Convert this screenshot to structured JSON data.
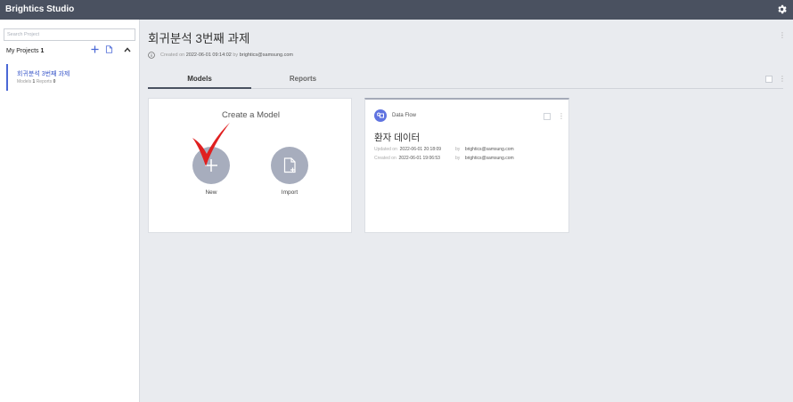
{
  "app": {
    "title": "Brightics Studio"
  },
  "sidebar": {
    "search_placeholder": "Search Project",
    "projects_label": "My Projects",
    "projects_count": "1",
    "projects": [
      {
        "title": "회귀분석 3번째 과제",
        "models_label": "Models",
        "models_count": "1",
        "reports_label": "Reports",
        "reports_count": "0"
      }
    ]
  },
  "project": {
    "title": "회귀분석 3번째 과제",
    "created_label": "Created on",
    "created_on": "2022-06-01 09:14:02",
    "by_label": "by",
    "created_by": "brightics@samsung.com"
  },
  "tabs": [
    {
      "label": "Models",
      "active": true
    },
    {
      "label": "Reports",
      "active": false
    }
  ],
  "create_model": {
    "title": "Create a Model",
    "new_label": "New",
    "import_label": "Import"
  },
  "models": [
    {
      "type": "Data Flow",
      "title": "환자 데이터",
      "updated_label": "Updated on",
      "updated_on": "2022-06-01 20:18:09",
      "updated_by_label": "by",
      "updated_by": "brightics@samsung.com",
      "created_label": "Created on",
      "created_on": "2022-06-01 19:06:53",
      "created_by_label": "by",
      "created_by": "brightics@samsung.com"
    }
  ],
  "colors": {
    "topbar": "#4a5160",
    "accent": "#4a68d6",
    "circle": "#a7adbd",
    "checkmark": "#e02020"
  },
  "icons": [
    "gear-icon",
    "plus-icon",
    "new-doc-icon",
    "chevron-up-icon",
    "info-icon",
    "plus-icon",
    "import-doc-icon",
    "data-flow-icon",
    "kebab-icon"
  ]
}
